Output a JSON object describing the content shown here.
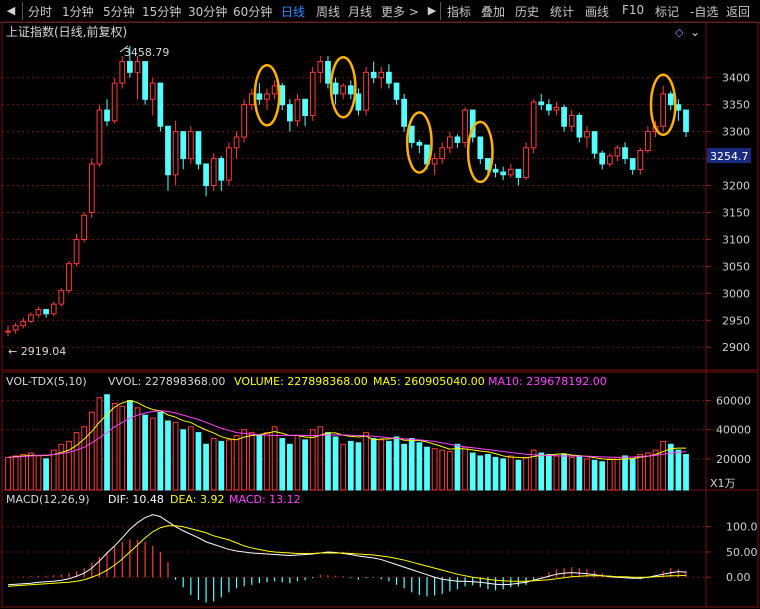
{
  "toolbar": {
    "left": [
      "分时",
      "1分钟",
      "5分钟",
      "15分钟",
      "30分钟",
      "60分钟",
      "日线",
      "周线",
      "月线",
      "更多 >"
    ],
    "active": "日线",
    "right": [
      "指标",
      "叠加",
      "历史",
      "统计",
      "画线",
      "F10",
      "标记",
      "-自选",
      "返回"
    ]
  },
  "main_panel": {
    "title": "上证指数(日线,前复权)",
    "high_label": "3458.79",
    "low_label": "2919.04",
    "price_tag": "3254.7",
    "y_ticks": [
      "3400",
      "3350",
      "3300",
      "3250",
      "3200",
      "3150",
      "3100",
      "3050",
      "3000",
      "2950",
      "2900"
    ],
    "y_values": [
      3400,
      3350,
      3300,
      3250,
      3200,
      3150,
      3100,
      3050,
      3000,
      2950,
      2900
    ]
  },
  "volume_panel": {
    "title": "VOL-TDX(5,10)",
    "vvol": "VVOL: 227898368.00",
    "volume": "VOLUME: 227898368.00",
    "ma5": "MA5: 260905040.00",
    "ma10": "MA10: 239678192.00",
    "y_ticks": [
      "60000",
      "40000",
      "20000"
    ],
    "y_values": [
      60000,
      40000,
      20000
    ],
    "unit": "X1万"
  },
  "macd_panel": {
    "title": "MACD(12,26,9)",
    "dif": "DIF: 10.48",
    "dea": "DEA: 3.92",
    "macd": "MACD: 13.12",
    "y_ticks": [
      "100.0",
      "50.00",
      "0.00"
    ],
    "y_values": [
      100,
      50,
      0
    ]
  },
  "colors": {
    "up": "#ff3b3b",
    "down": "#54ffff",
    "ma5": "#ffffff",
    "ma10": "#ffff00",
    "ma20": "#ff44ff",
    "highlight_circle": "#ffb000",
    "price_tag_bg": "#1a2a80",
    "dif_line": "#ffffff",
    "dea_line": "#ffff00"
  },
  "chart_data": [
    {
      "type": "candlestick",
      "title": "上证指数(日线,前复权)",
      "ylim": [
        2880,
        3470
      ],
      "candles": [
        [
          2930,
          2940,
          2920,
          2930
        ],
        [
          2932,
          2945,
          2925,
          2940
        ],
        [
          2940,
          2955,
          2935,
          2948
        ],
        [
          2948,
          2965,
          2945,
          2960
        ],
        [
          2960,
          2975,
          2955,
          2970
        ],
        [
          2970,
          2965,
          2955,
          2962
        ],
        [
          2962,
          2985,
          2958,
          2980
        ],
        [
          2980,
          3010,
          2975,
          3005
        ],
        [
          3005,
          3060,
          3000,
          3055
        ],
        [
          3055,
          3110,
          3050,
          3100
        ],
        [
          3100,
          3150,
          3095,
          3145
        ],
        [
          3150,
          3250,
          3140,
          3240
        ],
        [
          3240,
          3350,
          3235,
          3340
        ],
        [
          3340,
          3360,
          3310,
          3320
        ],
        [
          3320,
          3400,
          3315,
          3390
        ],
        [
          3390,
          3440,
          3380,
          3430
        ],
        [
          3430,
          3459,
          3400,
          3410
        ],
        [
          3410,
          3440,
          3360,
          3430
        ],
        [
          3430,
          3420,
          3350,
          3360
        ],
        [
          3360,
          3400,
          3330,
          3390
        ],
        [
          3390,
          3380,
          3300,
          3310
        ],
        [
          3310,
          3300,
          3190,
          3220
        ],
        [
          3220,
          3320,
          3200,
          3300
        ],
        [
          3300,
          3300,
          3230,
          3250
        ],
        [
          3250,
          3310,
          3240,
          3300
        ],
        [
          3300,
          3290,
          3230,
          3240
        ],
        [
          3240,
          3230,
          3180,
          3200
        ],
        [
          3200,
          3260,
          3190,
          3250
        ],
        [
          3250,
          3255,
          3190,
          3210
        ],
        [
          3210,
          3280,
          3200,
          3270
        ],
        [
          3270,
          3300,
          3250,
          3290
        ],
        [
          3290,
          3360,
          3280,
          3350
        ],
        [
          3350,
          3380,
          3340,
          3370
        ],
        [
          3370,
          3390,
          3350,
          3360
        ],
        [
          3360,
          3380,
          3340,
          3370
        ],
        [
          3370,
          3395,
          3360,
          3385
        ],
        [
          3385,
          3390,
          3340,
          3350
        ],
        [
          3350,
          3360,
          3300,
          3320
        ],
        [
          3320,
          3370,
          3310,
          3360
        ],
        [
          3360,
          3360,
          3310,
          3330
        ],
        [
          3330,
          3420,
          3320,
          3410
        ],
        [
          3410,
          3440,
          3390,
          3430
        ],
        [
          3430,
          3440,
          3380,
          3390
        ],
        [
          3390,
          3400,
          3350,
          3370
        ],
        [
          3370,
          3390,
          3360,
          3385
        ],
        [
          3385,
          3395,
          3360,
          3370
        ],
        [
          3370,
          3380,
          3330,
          3340
        ],
        [
          3340,
          3420,
          3330,
          3410
        ],
        [
          3410,
          3430,
          3390,
          3400
        ],
        [
          3400,
          3420,
          3380,
          3410
        ],
        [
          3410,
          3425,
          3380,
          3390
        ],
        [
          3390,
          3380,
          3350,
          3360
        ],
        [
          3360,
          3370,
          3300,
          3310
        ],
        [
          3310,
          3300,
          3270,
          3280
        ],
        [
          3280,
          3285,
          3260,
          3275
        ],
        [
          3275,
          3270,
          3230,
          3240
        ],
        [
          3240,
          3260,
          3220,
          3250
        ],
        [
          3250,
          3280,
          3240,
          3270
        ],
        [
          3270,
          3300,
          3260,
          3290
        ],
        [
          3290,
          3295,
          3270,
          3280
        ],
        [
          3280,
          3345,
          3270,
          3340
        ],
        [
          3340,
          3340,
          3280,
          3290
        ],
        [
          3290,
          3270,
          3240,
          3250
        ],
        [
          3250,
          3245,
          3220,
          3230
        ],
        [
          3230,
          3240,
          3215,
          3225
        ],
        [
          3225,
          3235,
          3210,
          3220
        ],
        [
          3220,
          3240,
          3215,
          3230
        ],
        [
          3230,
          3225,
          3200,
          3215
        ],
        [
          3215,
          3280,
          3210,
          3270
        ],
        [
          3270,
          3360,
          3260,
          3355
        ],
        [
          3355,
          3370,
          3340,
          3350
        ],
        [
          3350,
          3360,
          3330,
          3340
        ],
        [
          3340,
          3355,
          3330,
          3345
        ],
        [
          3345,
          3350,
          3300,
          3310
        ],
        [
          3310,
          3340,
          3300,
          3330
        ],
        [
          3330,
          3335,
          3280,
          3290
        ],
        [
          3290,
          3310,
          3270,
          3300
        ],
        [
          3300,
          3290,
          3250,
          3260
        ],
        [
          3260,
          3265,
          3230,
          3240
        ],
        [
          3240,
          3260,
          3235,
          3255
        ],
        [
          3255,
          3275,
          3245,
          3270
        ],
        [
          3270,
          3280,
          3240,
          3250
        ],
        [
          3250,
          3245,
          3220,
          3230
        ],
        [
          3230,
          3270,
          3220,
          3265
        ],
        [
          3265,
          3310,
          3260,
          3300
        ],
        [
          3300,
          3320,
          3290,
          3310
        ],
        [
          3310,
          3385,
          3300,
          3370
        ],
        [
          3370,
          3375,
          3340,
          3350
        ],
        [
          3350,
          3360,
          3320,
          3340
        ],
        [
          3340,
          3330,
          3290,
          3300
        ]
      ],
      "highlights_candle_index": [
        34,
        44,
        54,
        62,
        86
      ]
    },
    {
      "type": "bar",
      "title": "VOL-TDX(5,10)",
      "ylim": [
        0,
        70000
      ],
      "values": [
        21000,
        22000,
        23000,
        24000,
        22000,
        20000,
        26000,
        30000,
        32000,
        38000,
        42000,
        52000,
        62000,
        64000,
        58000,
        56000,
        60000,
        55000,
        50000,
        48000,
        52000,
        46000,
        45000,
        40000,
        42000,
        38000,
        30000,
        34000,
        32000,
        33000,
        36000,
        40000,
        38000,
        36000,
        38000,
        42000,
        34000,
        30000,
        36000,
        33000,
        40000,
        42000,
        38000,
        35000,
        30000,
        32000,
        31000,
        38000,
        34000,
        33000,
        32000,
        35000,
        30000,
        34000,
        31000,
        28000,
        27000,
        26000,
        25000,
        30000,
        28000,
        24000,
        22000,
        23000,
        21000,
        20000,
        22000,
        19000,
        21000,
        26000,
        24000,
        23000,
        22000,
        23000,
        21000,
        22000,
        20000,
        19000,
        18000,
        20000,
        21000,
        22000,
        20000,
        23000,
        24000,
        26000,
        32000,
        30000,
        26000,
        23000
      ],
      "up": [
        1,
        1,
        1,
        1,
        1,
        0,
        1,
        1,
        1,
        1,
        1,
        1,
        1,
        0,
        1,
        1,
        0,
        1,
        0,
        1,
        0,
        0,
        1,
        0,
        1,
        0,
        0,
        1,
        0,
        1,
        1,
        1,
        1,
        0,
        1,
        1,
        0,
        0,
        1,
        0,
        1,
        1,
        0,
        0,
        1,
        0,
        0,
        1,
        0,
        1,
        0,
        0,
        0,
        0,
        0,
        0,
        1,
        1,
        1,
        0,
        1,
        0,
        0,
        0,
        0,
        0,
        1,
        0,
        1,
        1,
        0,
        0,
        1,
        0,
        1,
        0,
        1,
        0,
        0,
        1,
        1,
        0,
        0,
        1,
        1,
        1,
        1,
        0,
        0,
        0
      ],
      "series": [
        {
          "name": "MA5",
          "values": [
            21000,
            21500,
            22000,
            22500,
            22400,
            22200,
            23000,
            24400,
            26000,
            29200,
            33600,
            38800,
            45200,
            50400,
            55600,
            58400,
            60000,
            58600,
            55800,
            53800,
            53000,
            50200,
            48600,
            46200,
            45000,
            42200,
            39800,
            37800,
            35200,
            33800,
            33000,
            35000,
            36000,
            36600,
            37600,
            38800,
            37600,
            36000,
            36000,
            35000,
            34600,
            36200,
            37800,
            37800,
            36200,
            35400,
            35000,
            35600,
            33000,
            33600,
            33600,
            34400,
            32800,
            32800,
            32600,
            31600,
            30000,
            28400,
            26600,
            27200,
            26800,
            26200,
            25400,
            24800,
            23600,
            22000,
            21200,
            21000,
            20600,
            21600,
            22400,
            22600,
            23200,
            23600,
            22600,
            22200,
            21600,
            20800,
            20000,
            19600,
            19600,
            20000,
            20200,
            21200,
            21800,
            23000,
            25000,
            27000,
            27400,
            27400
          ]
        },
        {
          "name": "MA10",
          "values": [
            21000,
            21200,
            21600,
            22000,
            22400,
            22600,
            23000,
            23600,
            24500,
            26000,
            28000,
            31000,
            34500,
            38000,
            42000,
            45000,
            48000,
            50000,
            51500,
            52500,
            53000,
            52500,
            51500,
            50000,
            48500,
            47000,
            45000,
            43000,
            41000,
            39500,
            38000,
            37500,
            37000,
            36500,
            36300,
            36000,
            36000,
            36200,
            36200,
            36000,
            36000,
            36100,
            36300,
            36500,
            36400,
            36200,
            36000,
            35800,
            35500,
            35000,
            34500,
            34000,
            33800,
            33400,
            33000,
            32500,
            32000,
            31000,
            30000,
            29000,
            28200,
            27600,
            27000,
            26300,
            25700,
            25000,
            24400,
            23800,
            23200,
            22800,
            22500,
            22300,
            22100,
            22000,
            22000,
            21900,
            21800,
            21600,
            21400,
            21200,
            21000,
            21100,
            21300,
            21600,
            22000,
            22500,
            23200,
            24000,
            24500,
            25000
          ]
        }
      ]
    },
    {
      "type": "bar",
      "title": "MACD(12,26,9)",
      "ylim": [
        -55,
        145
      ],
      "values": [
        0,
        0,
        1,
        2,
        3,
        3,
        4,
        5,
        8,
        12,
        18,
        28,
        40,
        50,
        60,
        70,
        75,
        74,
        70,
        62,
        50,
        30,
        -5,
        -20,
        -35,
        -45,
        -50,
        -48,
        -40,
        -30,
        -22,
        -18,
        -15,
        -12,
        -10,
        -8,
        -10,
        -12,
        -8,
        -6,
        -2,
        5,
        4,
        3,
        2,
        -2,
        -5,
        -2,
        -1,
        -4,
        -8,
        -15,
        -22,
        -30,
        -35,
        -38,
        -36,
        -33,
        -28,
        -24,
        -18,
        -16,
        -20,
        -24,
        -26,
        -24,
        -20,
        -18,
        -15,
        -8,
        2,
        10,
        15,
        18,
        20,
        18,
        16,
        12,
        8,
        4,
        2,
        0,
        -2,
        -4,
        -2,
        4,
        12,
        18,
        16,
        13
      ],
      "series": [
        {
          "name": "DIF",
          "values": [
            -15,
            -14,
            -13,
            -12,
            -10,
            -9,
            -8,
            -6,
            -3,
            2,
            8,
            18,
            32,
            48,
            62,
            78,
            95,
            108,
            118,
            124,
            120,
            110,
            100,
            92,
            85,
            78,
            70,
            65,
            60,
            55,
            52,
            50,
            48,
            47,
            46,
            45,
            44,
            43,
            44,
            45,
            46,
            48,
            50,
            49,
            47,
            45,
            42,
            40,
            38,
            35,
            30,
            25,
            20,
            15,
            10,
            5,
            0,
            -4,
            -6,
            -8,
            -8,
            -9,
            -10,
            -12,
            -14,
            -15,
            -14,
            -12,
            -10,
            -6,
            -2,
            2,
            6,
            8,
            9,
            8,
            7,
            5,
            3,
            1,
            0,
            -1,
            -2,
            -2,
            0,
            3,
            6,
            9,
            11,
            10
          ]
        },
        {
          "name": "DEA",
          "values": [
            -18,
            -17,
            -16,
            -15,
            -14,
            -13,
            -12,
            -11,
            -10,
            -8,
            -5,
            0,
            6,
            14,
            24,
            36,
            50,
            64,
            78,
            90,
            98,
            102,
            102,
            100,
            96,
            92,
            88,
            82,
            78,
            74,
            68,
            62,
            58,
            55,
            52,
            50,
            49,
            48,
            47,
            47,
            47,
            48,
            48,
            48,
            48,
            47,
            46,
            45,
            44,
            42,
            40,
            37,
            34,
            30,
            26,
            22,
            18,
            14,
            10,
            6,
            3,
            0,
            -2,
            -4,
            -6,
            -7,
            -8,
            -8,
            -8,
            -7,
            -6,
            -5,
            -3,
            -1,
            1,
            2,
            3,
            3,
            3,
            2,
            1,
            1,
            0,
            0,
            0,
            1,
            2,
            3,
            3,
            4
          ]
        }
      ]
    }
  ]
}
